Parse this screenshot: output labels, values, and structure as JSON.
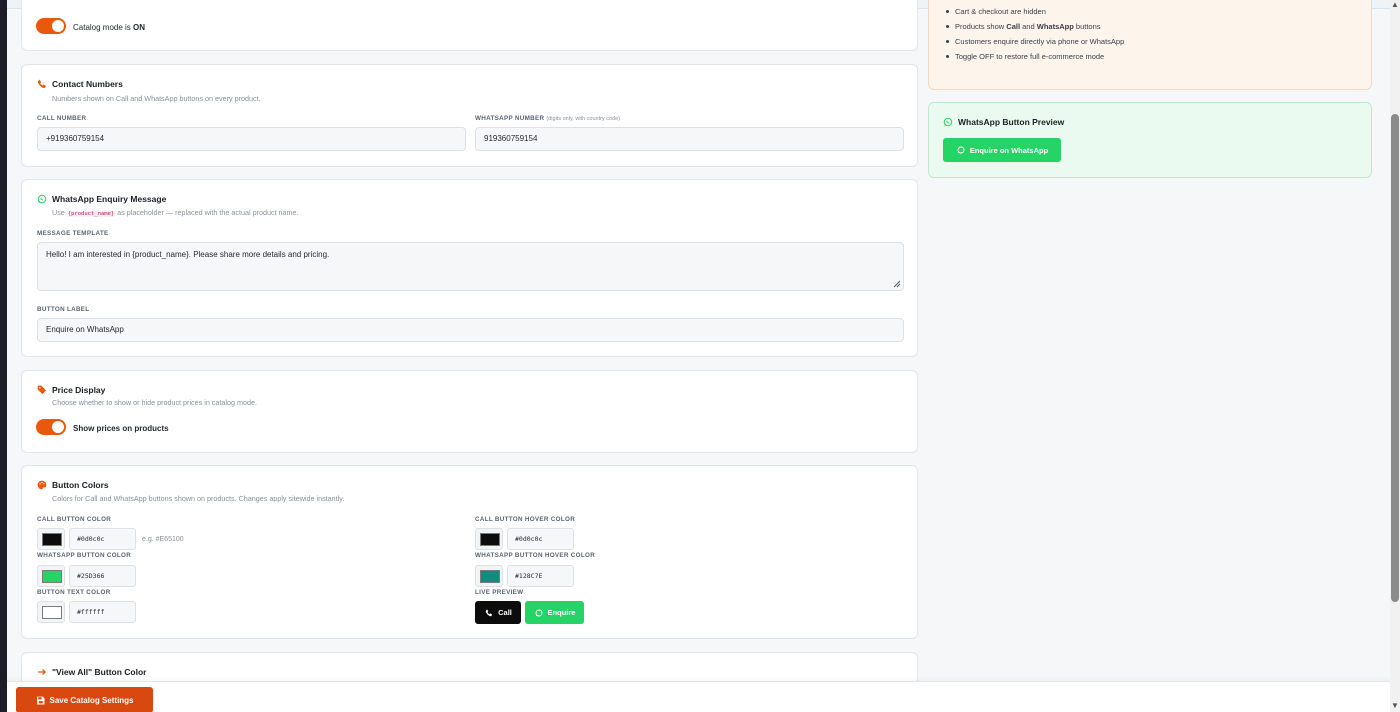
{
  "catalog_mode": {
    "label_prefix": "Catalog mode is ",
    "label_state": "ON"
  },
  "info": {
    "item0": "Cart & checkout are hidden",
    "item1_pre": "Products show ",
    "item1_call": "Call",
    "item1_mid": " and ",
    "item1_wa": "WhatsApp",
    "item1_post": " buttons",
    "item2": "Customers enquire directly via phone or WhatsApp",
    "item3": "Toggle OFF to restore full e-commerce mode"
  },
  "wa_preview": {
    "title": "WhatsApp Button Preview",
    "button_label": "Enquire on WhatsApp"
  },
  "contact": {
    "title": "Contact Numbers",
    "subtitle": "Numbers shown on Call and WhatsApp buttons on every product.",
    "call_label": "CALL NUMBER",
    "call_value": "+919360759154",
    "wa_label": "WHATSAPP NUMBER",
    "wa_hint": "(digits only, with country code)",
    "wa_value": "919360759154"
  },
  "enquiry": {
    "title": "WhatsApp Enquiry Message",
    "sub_pre": "Use ",
    "sub_code": "{product_name}",
    "sub_post": " as placeholder — replaced with the actual product name.",
    "template_label": "MESSAGE TEMPLATE",
    "template_value": "Hello! I am interested in {product_name}. Please share more details and pricing.",
    "button_label_label": "BUTTON LABEL",
    "button_label_value": "Enquire on WhatsApp"
  },
  "price": {
    "title": "Price Display",
    "subtitle": "Choose whether to show or hide product prices in catalog mode.",
    "toggle_label": "Show prices on products"
  },
  "colors": {
    "title": "Button Colors",
    "subtitle": "Colors for Call and WhatsApp buttons shown on products. Changes apply sitewide instantly.",
    "call_label": "CALL BUTTON COLOR",
    "call_value": "#0d0c0c",
    "call_eg": "e.g. #E65100",
    "call_hover_label": "CALL BUTTON HOVER COLOR",
    "call_hover_value": "#0d0c0c",
    "wa_label": "WHATSAPP BUTTON COLOR",
    "wa_value": "#25D366",
    "wa_hover_label": "WHATSAPP BUTTON HOVER COLOR",
    "wa_hover_value": "#128C7E",
    "text_label": "BUTTON TEXT COLOR",
    "text_value": "#ffffff",
    "live_label": "LIVE PREVIEW",
    "live_call": "Call",
    "live_enquire": "Enquire"
  },
  "view_all": {
    "title": "\"View All\" Button Color"
  },
  "save_button": "Save Catalog Settings",
  "palette": {
    "accent": "#e8590c",
    "whatsapp": "#25d366",
    "whatsapp_hover": "#128c7e",
    "call": "#0d0c0c",
    "text": "#ffffff"
  },
  "icons": [
    "phone-icon",
    "whatsapp-icon",
    "tag-icon",
    "palette-icon",
    "arrow-right-icon",
    "save-icon"
  ]
}
